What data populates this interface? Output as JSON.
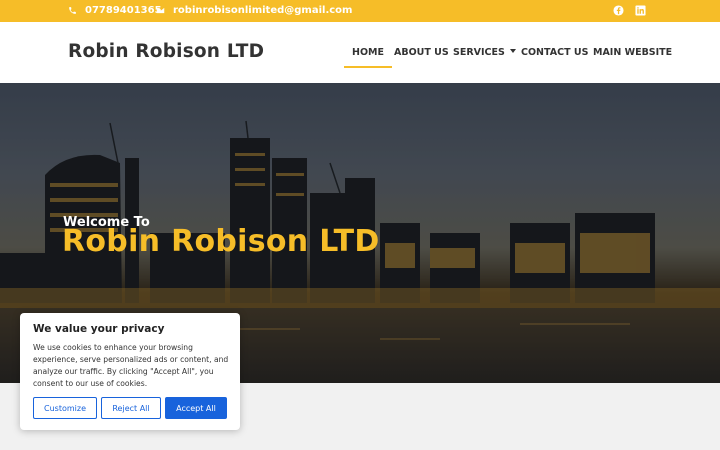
{
  "topbar": {
    "phone": "07789401365",
    "email": "robinrobisonlimited@gmail.com",
    "social": [
      "facebook-icon",
      "linkedin-icon"
    ],
    "bg_color": "#f6bd28"
  },
  "header": {
    "brand": "Robin Robison LTD",
    "nav": [
      {
        "label": "HOME",
        "active": true
      },
      {
        "label": "ABOUT US"
      },
      {
        "label": "SERVICES"
      },
      {
        "label": "CONTACT US"
      },
      {
        "label": "MAIN WEBSITE"
      }
    ]
  },
  "hero": {
    "welcome": "Welcome To",
    "title": "Robin Robison LTD",
    "accent_color": "#f6bd28"
  },
  "cookie": {
    "title": "We value your privacy",
    "text": "We use cookies to enhance your browsing experience, serve personalized ads or content, and analyze our traffic. By clicking \"Accept All\", you consent to our use of cookies.",
    "customize": "Customize",
    "reject": "Reject All",
    "accept": "Accept All",
    "button_color": "#1863dc"
  }
}
